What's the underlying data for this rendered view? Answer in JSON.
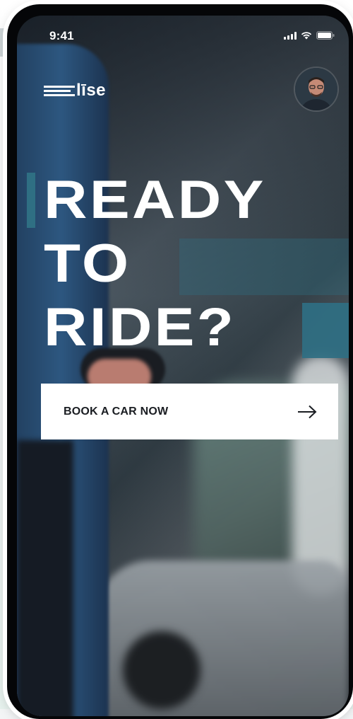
{
  "status_bar": {
    "time": "9:41",
    "icons": [
      "cellular-signal-icon",
      "wifi-icon",
      "battery-icon"
    ]
  },
  "header": {
    "logo_text": "līse",
    "avatar_icon": "user-avatar"
  },
  "hero": {
    "headline_lines": [
      "READY",
      "TO",
      "RIDE?"
    ]
  },
  "cta": {
    "label": "BOOK A CAR NOW",
    "icon": "arrow-right-icon"
  },
  "colors": {
    "accent": "#2f6f83",
    "cta_background": "#ffffff",
    "cta_text": "#1a1d22",
    "headline": "#ffffff"
  }
}
